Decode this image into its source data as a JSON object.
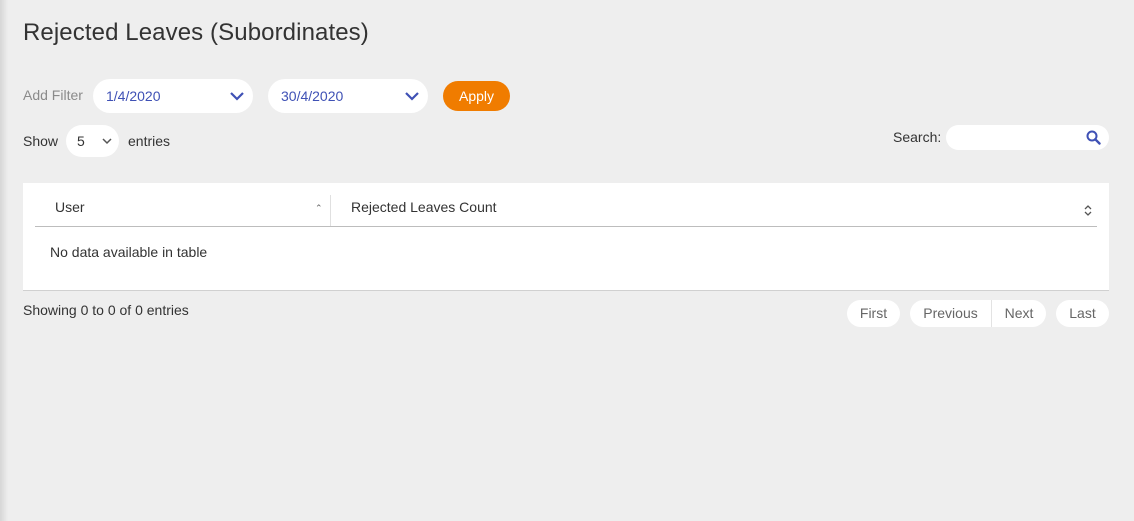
{
  "page": {
    "title": "Rejected Leaves (Subordinates)"
  },
  "filter": {
    "label": "Add Filter",
    "date_from": "1/4/2020",
    "date_to": "30/4/2020",
    "apply_label": "Apply",
    "accent_color": "#f07c00",
    "select_text_color": "#3f51b5"
  },
  "length_control": {
    "show_label": "Show",
    "value": "5",
    "entries_label": "entries"
  },
  "search": {
    "label": "Search:",
    "value": "",
    "icon": "search-icon"
  },
  "table": {
    "columns": [
      "User",
      "Rejected Leaves Count"
    ],
    "empty_message": "No data available in table"
  },
  "info": "Showing 0 to 0 of 0 entries",
  "pagination": {
    "first": "First",
    "previous": "Previous",
    "next": "Next",
    "last": "Last"
  }
}
